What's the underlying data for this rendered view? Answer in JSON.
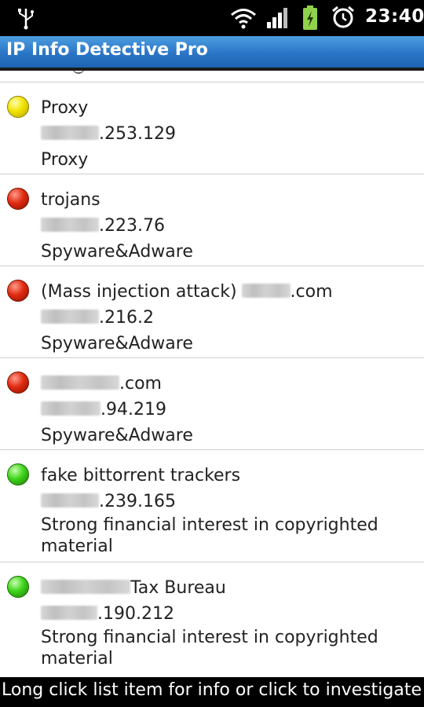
{
  "status_bar": {
    "time": "23:40",
    "icons": [
      "usb-icon",
      "wifi-icon",
      "signal-icon",
      "battery-charging-icon",
      "alarm-icon"
    ]
  },
  "app": {
    "title": "IP Info Detective Pro"
  },
  "list": {
    "items": [
      {
        "status": "yellow",
        "name": "Proxy",
        "name_suffix": "",
        "ip_suffix": ".253.129",
        "category": "Proxy"
      },
      {
        "status": "red",
        "name": "trojans",
        "name_suffix": "",
        "ip_suffix": ".223.76",
        "category": "Spyware&Adware"
      },
      {
        "status": "red",
        "name": "(Mass injection attack)",
        "name_suffix": ".com",
        "ip_suffix": ".216.2",
        "category": "Spyware&Adware"
      },
      {
        "status": "red",
        "name": "",
        "name_suffix": ".com",
        "ip_suffix": ".94.219",
        "category": "Spyware&Adware"
      },
      {
        "status": "green",
        "name": "fake bittorrent trackers",
        "name_suffix": "",
        "ip_suffix": ".239.165",
        "category": "Strong financial interest in copyrighted material"
      },
      {
        "status": "green",
        "name": "",
        "name_suffix": "Tax Bureau",
        "ip_suffix": ".190.212",
        "category": "Strong financial interest in copyrighted material"
      }
    ]
  },
  "footer": {
    "hint": "Long click list item for info or click to investigate IP"
  },
  "colors": {
    "title_bar": "#2a75c7",
    "status_yellow": "#f2e200",
    "status_red": "#e02a10",
    "status_green": "#3ed41a"
  }
}
